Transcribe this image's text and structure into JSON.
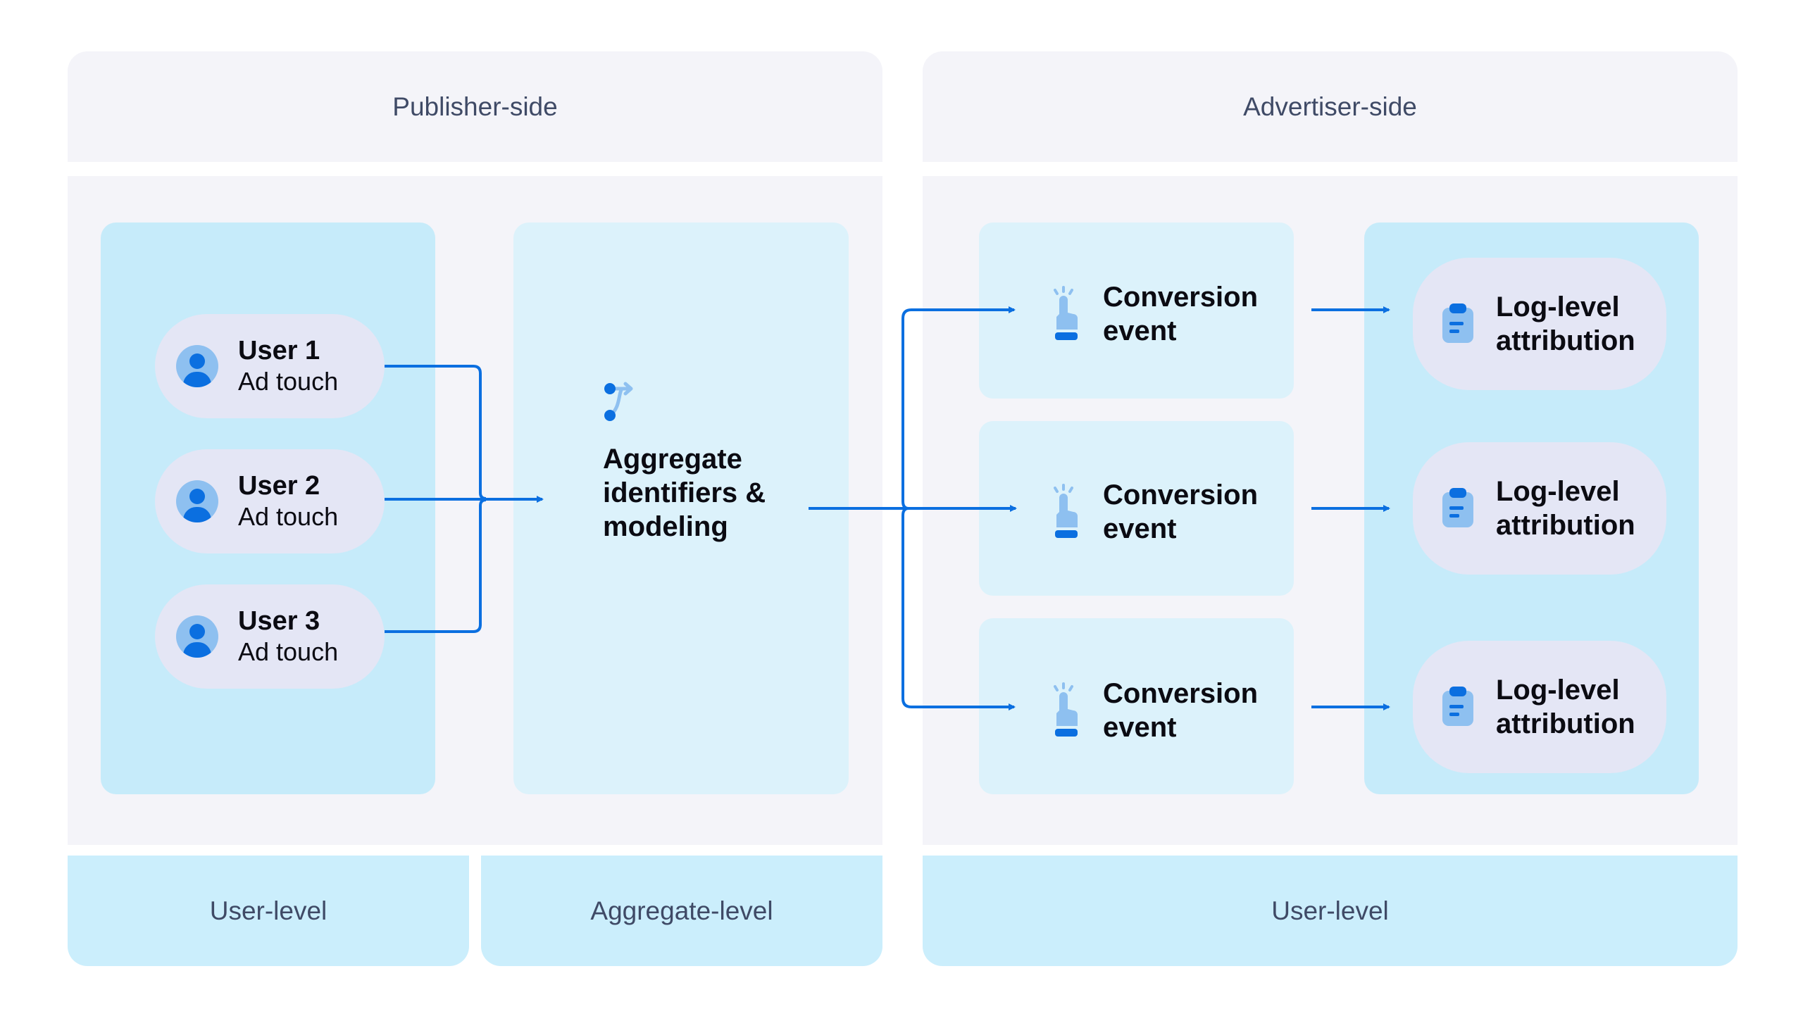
{
  "headers": {
    "publisher": "Publisher-side",
    "advertiser": "Advertiser-side"
  },
  "users": [
    {
      "name": "User 1",
      "sub": "Ad touch"
    },
    {
      "name": "User 2",
      "sub": "Ad touch"
    },
    {
      "name": "User 3",
      "sub": "Ad touch"
    }
  ],
  "aggregate": {
    "line1": "Aggregate",
    "line2": "identifiers &",
    "line3": "modeling"
  },
  "conversions": [
    {
      "line1": "Conversion",
      "line2": "event"
    },
    {
      "line1": "Conversion",
      "line2": "event"
    },
    {
      "line1": "Conversion",
      "line2": "event"
    }
  ],
  "attributions": [
    {
      "line1": "Log-level",
      "line2": "attribution"
    },
    {
      "line1": "Log-level",
      "line2": "attribution"
    },
    {
      "line1": "Log-level",
      "line2": "attribution"
    }
  ],
  "footers": {
    "publisher_user": "User-level",
    "publisher_aggregate": "Aggregate-level",
    "advertiser_user": "User-level"
  },
  "colors": {
    "accent": "#0b6fe0",
    "accent_light": "#8ec0f0",
    "panel_bg": "#f4f4f9",
    "column_blue": "#c6ebfa",
    "column_light": "#dcf2fb",
    "pill_bg": "#e4e6f5",
    "label_text": "#3f4a66"
  },
  "icons": {
    "user": "user-avatar-icon",
    "aggregate": "merge-branch-icon",
    "conversion": "tap-finger-icon",
    "attribution": "clipboard-icon"
  }
}
